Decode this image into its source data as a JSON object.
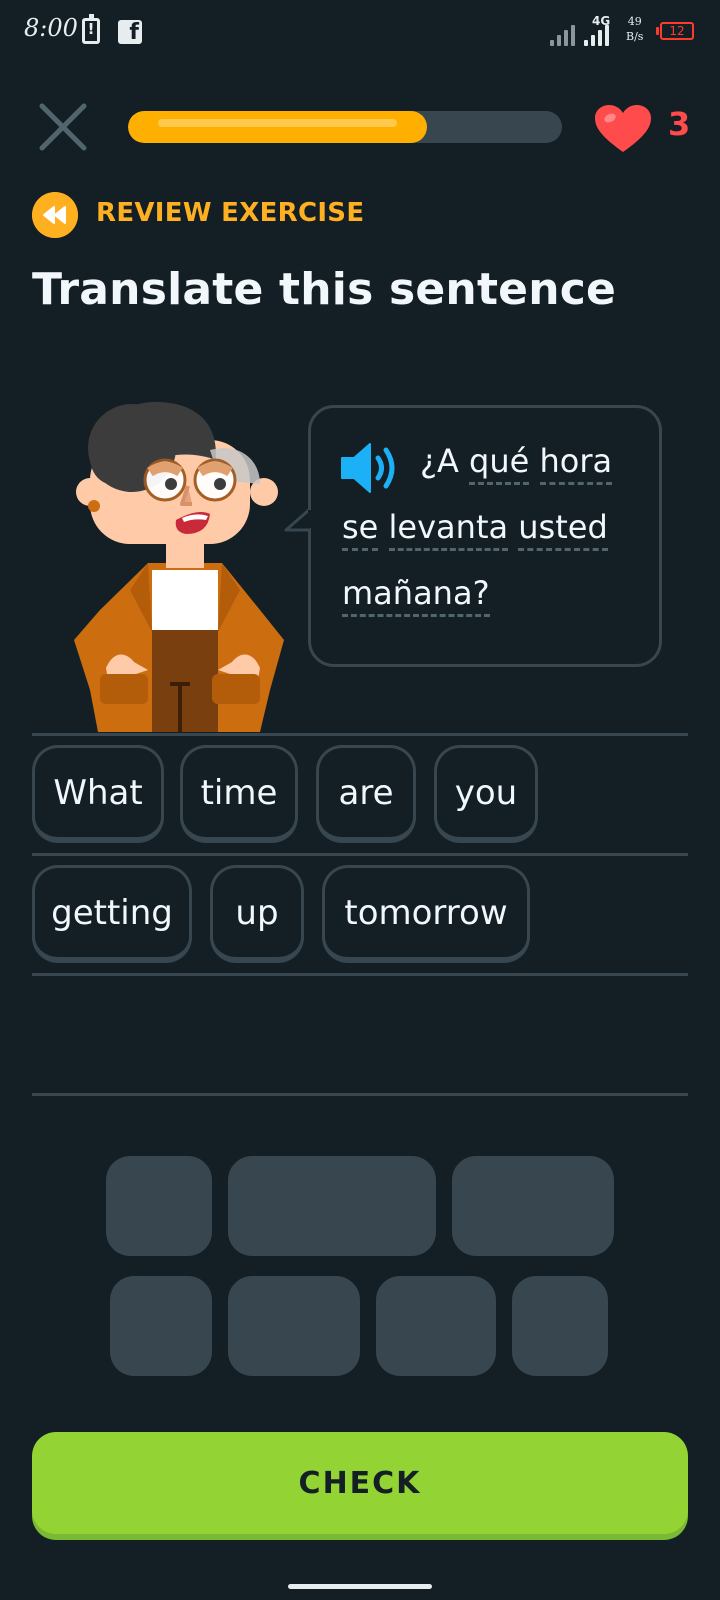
{
  "status_bar": {
    "time": "8:00",
    "network": "4G",
    "speed_value": "49",
    "speed_unit": "B/s",
    "battery": "12"
  },
  "header": {
    "progress_fraction": 0.69,
    "hearts": "3"
  },
  "exercise": {
    "badge_label": "REVIEW EXERCISE",
    "title": "Translate this sentence",
    "prompt_words": [
      "¿A",
      "qué",
      "hora",
      "se",
      "levanta",
      "usted",
      "mañana?"
    ]
  },
  "answer_words": [
    "What",
    "time",
    "are",
    "you",
    "getting",
    "up",
    "tomorrow"
  ],
  "word_bank_slots": 7,
  "check_label": "CHECK",
  "colors": {
    "background": "#131f24",
    "border": "#37464f",
    "progress": "#ffaf00",
    "heart": "#ff4b4b",
    "badge": "#ffb020",
    "check": "#93d333",
    "speaker": "#1cb0f6"
  },
  "icons": {
    "close": "close-icon",
    "heart": "heart-icon",
    "review": "rewind-icon",
    "speaker": "speaker-icon"
  }
}
